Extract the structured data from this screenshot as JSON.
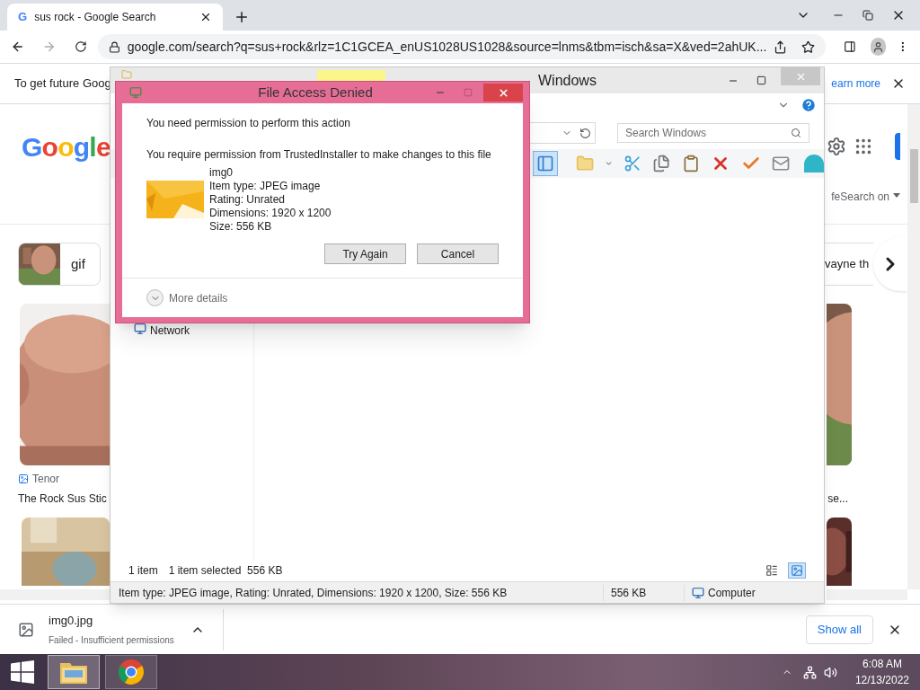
{
  "browser": {
    "tab": {
      "favicon": "G",
      "title": "sus rock - Google Search"
    },
    "url": "google.com/search?q=sus+rock&rlz=1C1GCEA_enUS1028US1028&source=lnms&tbm=isch&sa=X&ved=2ahUK...",
    "infobar": {
      "text": "To get future Goog",
      "link": "earn more"
    },
    "logo": "Google",
    "safesearch": "feSearch on",
    "chips": [
      {
        "label": "gif"
      },
      {
        "label": "vayne th"
      }
    ],
    "results": [
      {
        "source": "Tenor",
        "title": "The Rock Sus Stic"
      },
      {
        "title": "se..."
      }
    ]
  },
  "downloads": {
    "file": "img0.jpg",
    "status": "Failed - Insufficient permissions",
    "show_all": "Show all"
  },
  "explorer": {
    "title": "Windows",
    "search": {
      "placeholder": "Search Windows"
    },
    "nav": [
      "Network"
    ],
    "item_count": "1 item",
    "selection": "1 item selected  556 KB",
    "details": "Item type: JPEG image, Rating: Unrated, Dimensions: 1920 x 1200, Size: 556 KB",
    "size": "556 KB",
    "location": "Computer",
    "views": [
      {
        "kind": "details",
        "selected": false
      },
      {
        "kind": "preview",
        "selected": true
      }
    ]
  },
  "dialog": {
    "title": "File Access Denied",
    "message": "You need permission to perform this action",
    "detail": "You require permission from TrustedInstaller to make changes to this file",
    "file": [
      "img0",
      "Item type: JPEG image",
      "Rating: Unrated",
      "Dimensions: 1920 x 1200",
      "Size: 556 KB"
    ],
    "buttons": [
      "Try Again",
      "Cancel"
    ],
    "more": "More details"
  },
  "taskbar": {
    "apps": [
      {
        "kind": "explorer",
        "selected": true
      },
      {
        "kind": "chrome",
        "selected": false
      }
    ],
    "time": "6:08 AM",
    "date": "12/13/2022"
  }
}
